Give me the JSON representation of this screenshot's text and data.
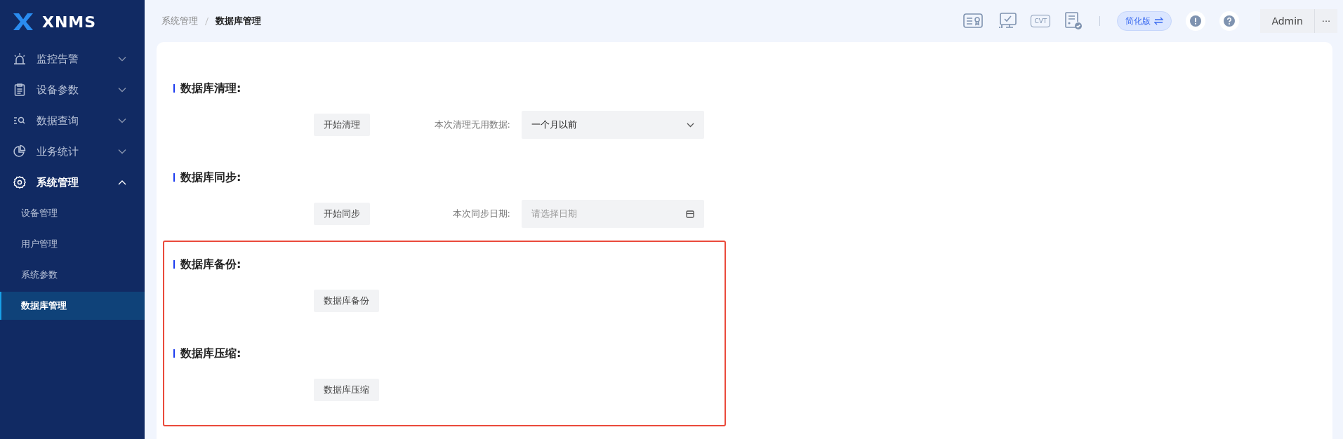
{
  "sidebar": {
    "logo": "XNMS",
    "menu": [
      {
        "label": "监控告警",
        "expanded": false
      },
      {
        "label": "设备参数",
        "expanded": false
      },
      {
        "label": "数据查询",
        "expanded": false
      },
      {
        "label": "业务统计",
        "expanded": false
      },
      {
        "label": "系统管理",
        "expanded": true,
        "children": [
          {
            "label": "设备管理",
            "selected": false
          },
          {
            "label": "用户管理",
            "selected": false
          },
          {
            "label": "系统参数",
            "selected": false
          },
          {
            "label": "数据库管理",
            "selected": true
          }
        ]
      }
    ]
  },
  "header": {
    "breadcrumb": [
      "系统管理",
      "数据库管理"
    ],
    "icon_label": "CVT",
    "mode_badge": "简化版",
    "user": "Admin",
    "more": "···"
  },
  "sections": [
    {
      "title": "数据库清理:",
      "button": "开始清理",
      "highlighted": false,
      "field": {
        "kind": "select",
        "label": "本次清理无用数据:",
        "value": "一个月以前"
      }
    },
    {
      "title": "数据库同步:",
      "button": "开始同步",
      "highlighted": false,
      "field": {
        "kind": "date",
        "label": "本次同步日期:",
        "placeholder": "请选择日期"
      }
    },
    {
      "title": "数据库备份:",
      "button": "数据库备份",
      "highlighted": true
    },
    {
      "title": "数据库压缩:",
      "button": "数据库压缩",
      "highlighted": true
    }
  ]
}
